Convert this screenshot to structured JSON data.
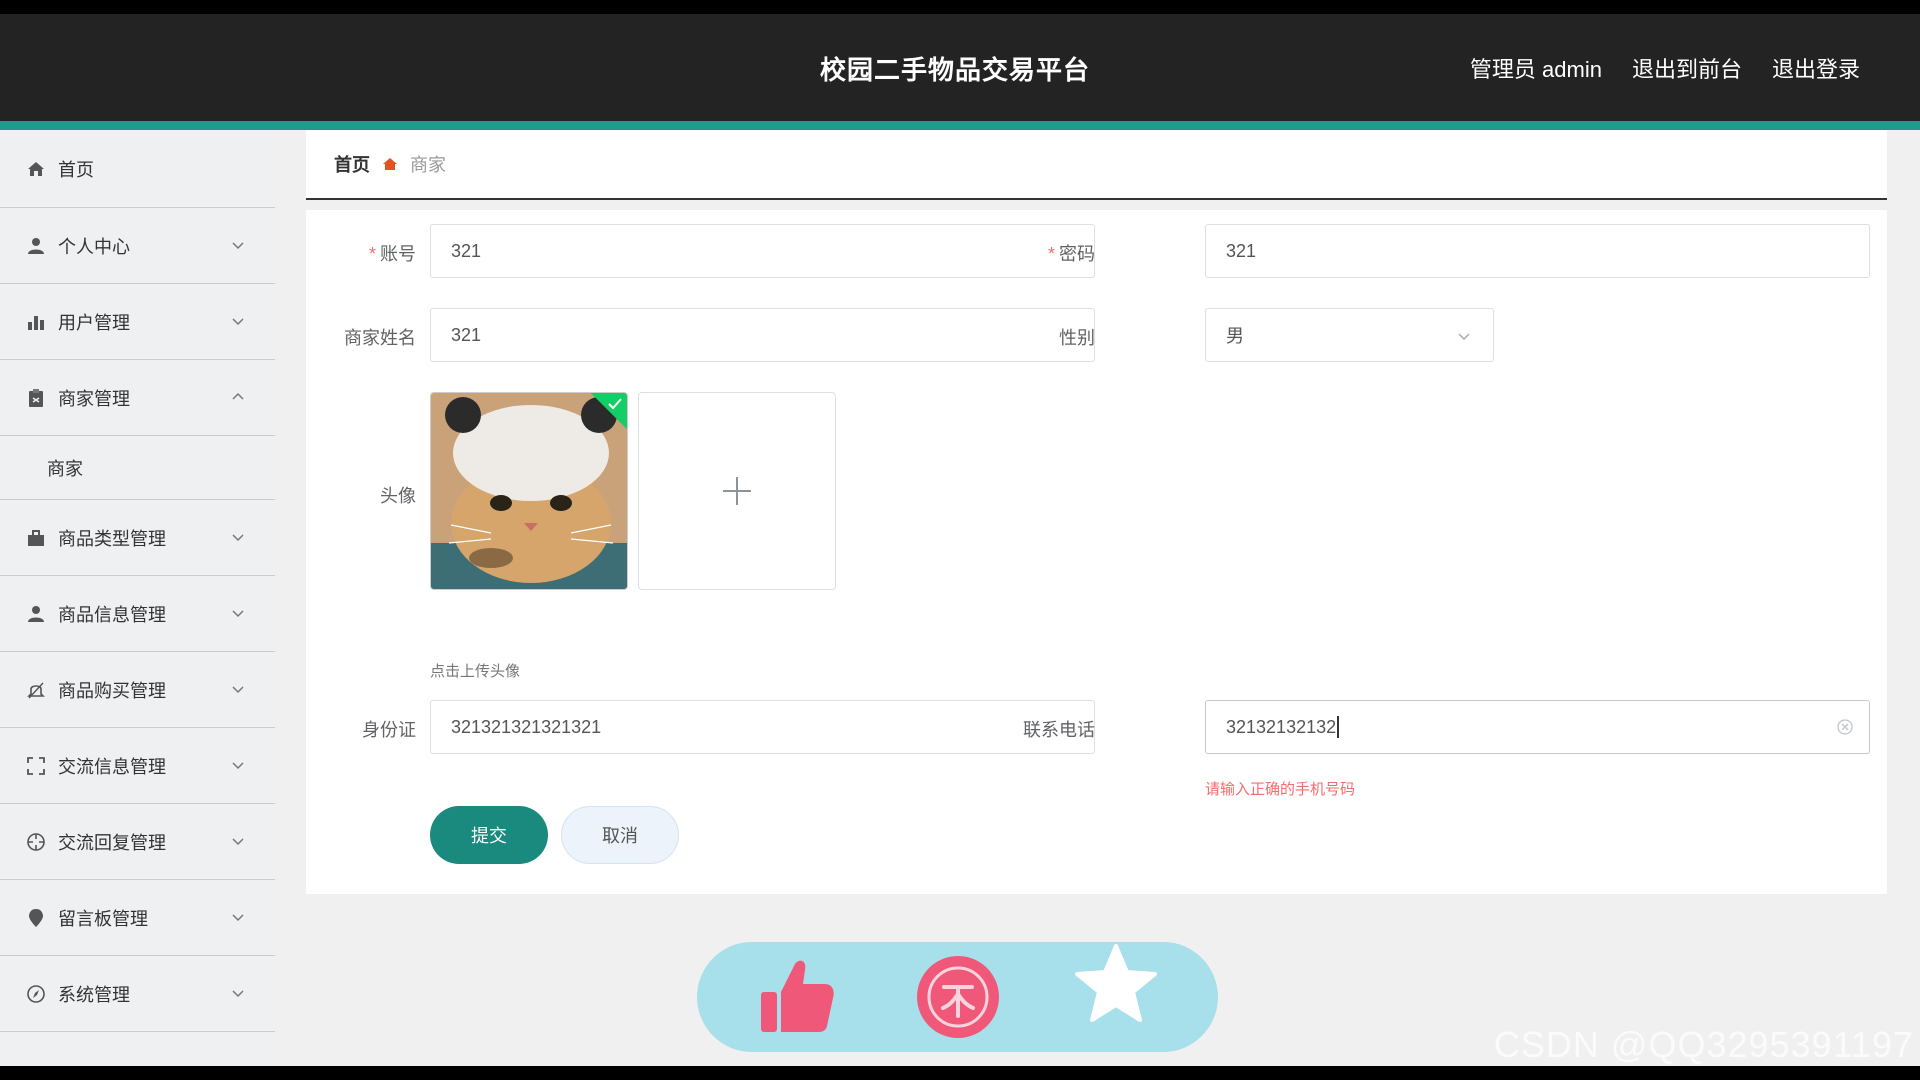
{
  "header": {
    "title": "校园二手物品交易平台",
    "admin_label": "管理员 admin",
    "back_front": "退出到前台",
    "logout": "退出登录"
  },
  "sidebar": {
    "items": [
      {
        "label": "首页",
        "icon": "home-icon"
      },
      {
        "label": "个人中心",
        "icon": "user-icon"
      },
      {
        "label": "用户管理",
        "icon": "bar-chart-icon"
      },
      {
        "label": "商家管理",
        "icon": "clipboard-icon",
        "expanded": true,
        "children": [
          "商家"
        ]
      },
      {
        "label": "商品类型管理",
        "icon": "briefcase-icon"
      },
      {
        "label": "商品信息管理",
        "icon": "person-icon"
      },
      {
        "label": "商品购买管理",
        "icon": "bell-icon"
      },
      {
        "label": "交流信息管理",
        "icon": "fullscreen-icon"
      },
      {
        "label": "交流回复管理",
        "icon": "crosshair-icon"
      },
      {
        "label": "留言板管理",
        "icon": "location-icon"
      },
      {
        "label": "系统管理",
        "icon": "compass-icon"
      }
    ]
  },
  "breadcrumb": {
    "home": "首页",
    "current": "商家"
  },
  "form": {
    "account_label": "账号",
    "account_value": "321",
    "password_label": "密码",
    "password_value": "321",
    "name_label": "商家姓名",
    "name_value": "321",
    "gender_label": "性别",
    "gender_value": "男",
    "avatar_label": "头像",
    "avatar_hint": "点击上传头像",
    "idcard_label": "身份证",
    "idcard_value": "321321321321321",
    "phone_label": "联系电话",
    "phone_value": "32132132132",
    "phone_error": "请输入正确的手机号码",
    "submit": "提交",
    "cancel": "取消"
  },
  "colors": {
    "header_bg": "#232323",
    "accent": "#1f9a8c",
    "primary_button": "#1a8a7e",
    "error": "#f56c6c",
    "action_pill": "#a7dfea",
    "action_pink": "#f0587a"
  },
  "watermark": "CSDN @QQ3295391197"
}
